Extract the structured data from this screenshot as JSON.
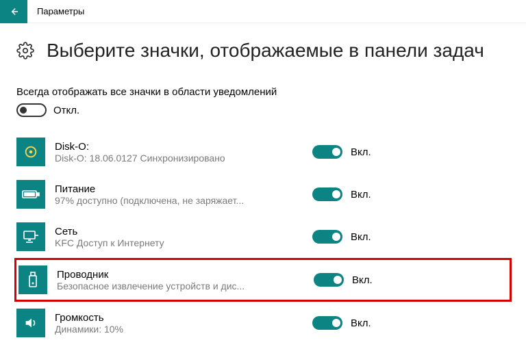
{
  "titlebar": {
    "title": "Параметры"
  },
  "page": {
    "heading": "Выберите значки, отображаемые в панели задач"
  },
  "always_show": {
    "label": "Всегда отображать все значки в области уведомлений",
    "state_label": "Откл."
  },
  "state_on": "Вкл.",
  "items": [
    {
      "title": "Disk-O:",
      "subtitle": "Disk-O: 18.06.0127 Синхронизировано"
    },
    {
      "title": "Питание",
      "subtitle": "97% доступно (подключена, не заряжает..."
    },
    {
      "title": "Сеть",
      "subtitle": "KFC Доступ к Интернету"
    },
    {
      "title": "Проводник",
      "subtitle": "Безопасное извлечение устройств и дис..."
    },
    {
      "title": "Громкость",
      "subtitle": "Динамики: 10%"
    }
  ]
}
